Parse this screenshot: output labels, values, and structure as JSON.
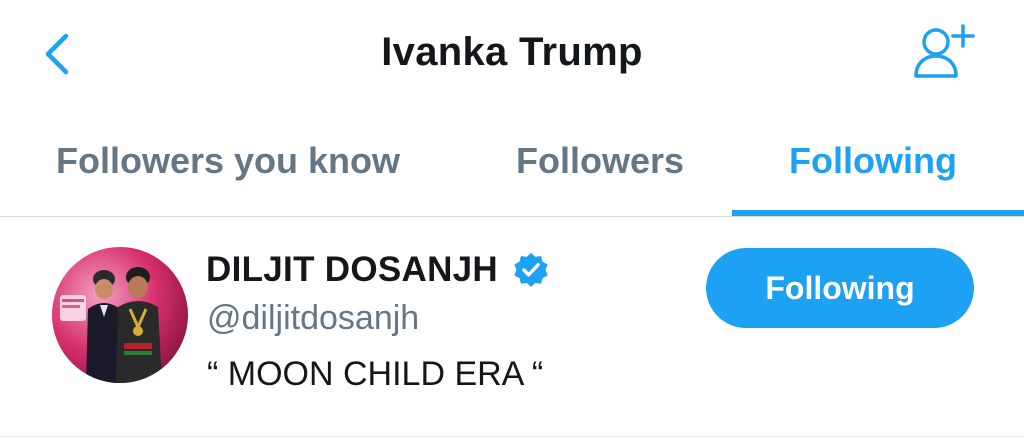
{
  "header": {
    "title": "Ivanka Trump",
    "back_icon": "chevron-left-icon",
    "add_icon": "add-user-icon"
  },
  "tabs": [
    {
      "label": "Followers you know",
      "active": false
    },
    {
      "label": "Followers",
      "active": false
    },
    {
      "label": "Following",
      "active": true
    }
  ],
  "users": [
    {
      "name": "DILJIT DOSANJH",
      "verified": true,
      "handle": "@diljitdosanjh",
      "bio": "“ MOON CHILD ERA “",
      "button_label": "Following"
    }
  ],
  "colors": {
    "accent": "#1da1f2",
    "secondary_text": "#657786",
    "primary_text": "#14171a"
  }
}
